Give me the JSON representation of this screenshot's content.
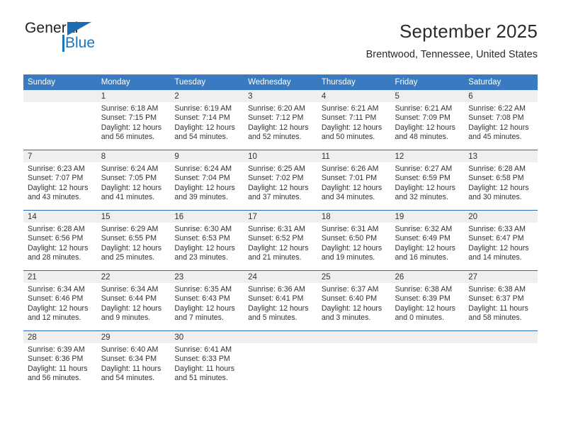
{
  "brand": {
    "name_part1": "General",
    "name_part2": "Blue",
    "logo_icon": "triangle-flag-icon"
  },
  "header": {
    "title": "September 2025",
    "location": "Brentwood, Tennessee, United States"
  },
  "colors": {
    "header_blue": "#3a7ac0",
    "row_divider_blue": "#2a6cb4",
    "daynum_band": "#efefef",
    "brand_blue": "#1b75bb",
    "text": "#333333"
  },
  "weekday_headers": [
    "Sunday",
    "Monday",
    "Tuesday",
    "Wednesday",
    "Thursday",
    "Friday",
    "Saturday"
  ],
  "weeks": [
    [
      {
        "day": "",
        "lines": []
      },
      {
        "day": "1",
        "lines": [
          "Sunrise: 6:18 AM",
          "Sunset: 7:15 PM",
          "Daylight: 12 hours",
          "and 56 minutes."
        ]
      },
      {
        "day": "2",
        "lines": [
          "Sunrise: 6:19 AM",
          "Sunset: 7:14 PM",
          "Daylight: 12 hours",
          "and 54 minutes."
        ]
      },
      {
        "day": "3",
        "lines": [
          "Sunrise: 6:20 AM",
          "Sunset: 7:12 PM",
          "Daylight: 12 hours",
          "and 52 minutes."
        ]
      },
      {
        "day": "4",
        "lines": [
          "Sunrise: 6:21 AM",
          "Sunset: 7:11 PM",
          "Daylight: 12 hours",
          "and 50 minutes."
        ]
      },
      {
        "day": "5",
        "lines": [
          "Sunrise: 6:21 AM",
          "Sunset: 7:09 PM",
          "Daylight: 12 hours",
          "and 48 minutes."
        ]
      },
      {
        "day": "6",
        "lines": [
          "Sunrise: 6:22 AM",
          "Sunset: 7:08 PM",
          "Daylight: 12 hours",
          "and 45 minutes."
        ]
      }
    ],
    [
      {
        "day": "7",
        "lines": [
          "Sunrise: 6:23 AM",
          "Sunset: 7:07 PM",
          "Daylight: 12 hours",
          "and 43 minutes."
        ]
      },
      {
        "day": "8",
        "lines": [
          "Sunrise: 6:24 AM",
          "Sunset: 7:05 PM",
          "Daylight: 12 hours",
          "and 41 minutes."
        ]
      },
      {
        "day": "9",
        "lines": [
          "Sunrise: 6:24 AM",
          "Sunset: 7:04 PM",
          "Daylight: 12 hours",
          "and 39 minutes."
        ]
      },
      {
        "day": "10",
        "lines": [
          "Sunrise: 6:25 AM",
          "Sunset: 7:02 PM",
          "Daylight: 12 hours",
          "and 37 minutes."
        ]
      },
      {
        "day": "11",
        "lines": [
          "Sunrise: 6:26 AM",
          "Sunset: 7:01 PM",
          "Daylight: 12 hours",
          "and 34 minutes."
        ]
      },
      {
        "day": "12",
        "lines": [
          "Sunrise: 6:27 AM",
          "Sunset: 6:59 PM",
          "Daylight: 12 hours",
          "and 32 minutes."
        ]
      },
      {
        "day": "13",
        "lines": [
          "Sunrise: 6:28 AM",
          "Sunset: 6:58 PM",
          "Daylight: 12 hours",
          "and 30 minutes."
        ]
      }
    ],
    [
      {
        "day": "14",
        "lines": [
          "Sunrise: 6:28 AM",
          "Sunset: 6:56 PM",
          "Daylight: 12 hours",
          "and 28 minutes."
        ]
      },
      {
        "day": "15",
        "lines": [
          "Sunrise: 6:29 AM",
          "Sunset: 6:55 PM",
          "Daylight: 12 hours",
          "and 25 minutes."
        ]
      },
      {
        "day": "16",
        "lines": [
          "Sunrise: 6:30 AM",
          "Sunset: 6:53 PM",
          "Daylight: 12 hours",
          "and 23 minutes."
        ]
      },
      {
        "day": "17",
        "lines": [
          "Sunrise: 6:31 AM",
          "Sunset: 6:52 PM",
          "Daylight: 12 hours",
          "and 21 minutes."
        ]
      },
      {
        "day": "18",
        "lines": [
          "Sunrise: 6:31 AM",
          "Sunset: 6:50 PM",
          "Daylight: 12 hours",
          "and 19 minutes."
        ]
      },
      {
        "day": "19",
        "lines": [
          "Sunrise: 6:32 AM",
          "Sunset: 6:49 PM",
          "Daylight: 12 hours",
          "and 16 minutes."
        ]
      },
      {
        "day": "20",
        "lines": [
          "Sunrise: 6:33 AM",
          "Sunset: 6:47 PM",
          "Daylight: 12 hours",
          "and 14 minutes."
        ]
      }
    ],
    [
      {
        "day": "21",
        "lines": [
          "Sunrise: 6:34 AM",
          "Sunset: 6:46 PM",
          "Daylight: 12 hours",
          "and 12 minutes."
        ]
      },
      {
        "day": "22",
        "lines": [
          "Sunrise: 6:34 AM",
          "Sunset: 6:44 PM",
          "Daylight: 12 hours",
          "and 9 minutes."
        ]
      },
      {
        "day": "23",
        "lines": [
          "Sunrise: 6:35 AM",
          "Sunset: 6:43 PM",
          "Daylight: 12 hours",
          "and 7 minutes."
        ]
      },
      {
        "day": "24",
        "lines": [
          "Sunrise: 6:36 AM",
          "Sunset: 6:41 PM",
          "Daylight: 12 hours",
          "and 5 minutes."
        ]
      },
      {
        "day": "25",
        "lines": [
          "Sunrise: 6:37 AM",
          "Sunset: 6:40 PM",
          "Daylight: 12 hours",
          "and 3 minutes."
        ]
      },
      {
        "day": "26",
        "lines": [
          "Sunrise: 6:38 AM",
          "Sunset: 6:39 PM",
          "Daylight: 12 hours",
          "and 0 minutes."
        ]
      },
      {
        "day": "27",
        "lines": [
          "Sunrise: 6:38 AM",
          "Sunset: 6:37 PM",
          "Daylight: 11 hours",
          "and 58 minutes."
        ]
      }
    ],
    [
      {
        "day": "28",
        "lines": [
          "Sunrise: 6:39 AM",
          "Sunset: 6:36 PM",
          "Daylight: 11 hours",
          "and 56 minutes."
        ]
      },
      {
        "day": "29",
        "lines": [
          "Sunrise: 6:40 AM",
          "Sunset: 6:34 PM",
          "Daylight: 11 hours",
          "and 54 minutes."
        ]
      },
      {
        "day": "30",
        "lines": [
          "Sunrise: 6:41 AM",
          "Sunset: 6:33 PM",
          "Daylight: 11 hours",
          "and 51 minutes."
        ]
      },
      {
        "day": "",
        "lines": []
      },
      {
        "day": "",
        "lines": []
      },
      {
        "day": "",
        "lines": []
      },
      {
        "day": "",
        "lines": []
      }
    ]
  ]
}
